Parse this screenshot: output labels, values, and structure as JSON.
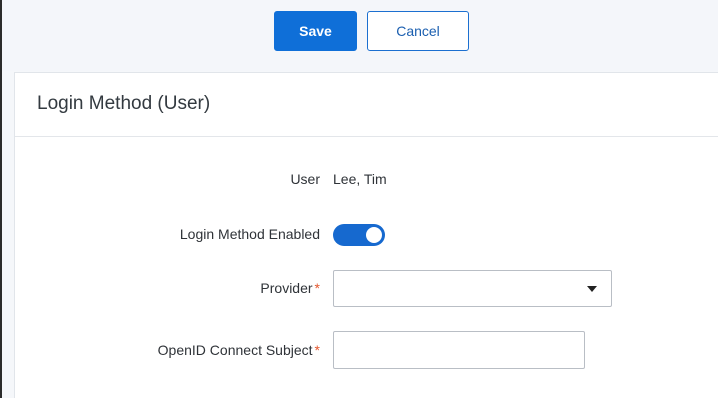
{
  "toolbar": {
    "save_label": "Save",
    "cancel_label": "Cancel"
  },
  "panel": {
    "title": "Login Method (User)"
  },
  "form": {
    "user": {
      "label": "User",
      "value": "Lee, Tim"
    },
    "enabled": {
      "label": "Login Method Enabled",
      "value": true
    },
    "provider": {
      "label": "Provider",
      "required_mark": "*",
      "value": ""
    },
    "subject": {
      "label": "OpenID Connect Subject",
      "required_mark": "*",
      "value": "",
      "placeholder": ""
    }
  },
  "colors": {
    "primary": "#0f6fd8",
    "required": "#e4572e",
    "toggle_on": "#1669cf"
  },
  "icons": {
    "provider_dropdown": "chevron-down-icon"
  }
}
